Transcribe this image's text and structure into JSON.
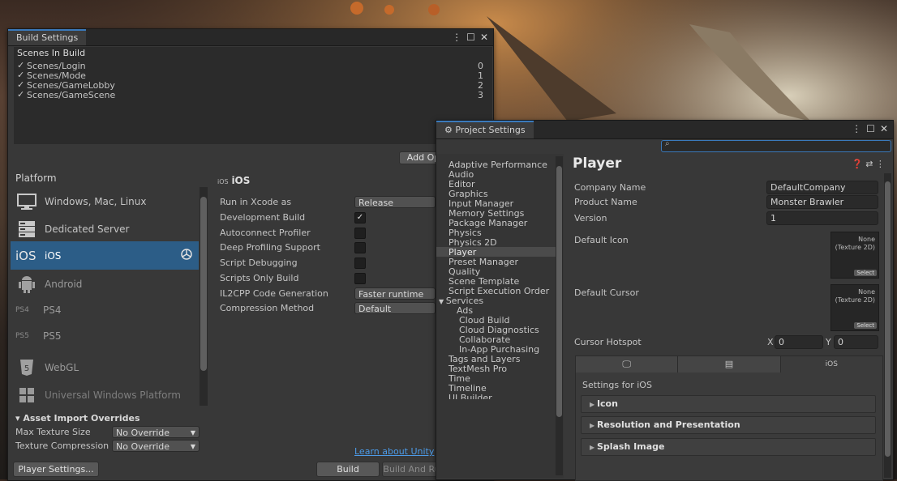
{
  "build_settings": {
    "tab_title": "Build Settings",
    "scenes_header": "Scenes In Build",
    "scenes": [
      {
        "name": "Scenes/Login",
        "index": "0"
      },
      {
        "name": "Scenes/Mode",
        "index": "1"
      },
      {
        "name": "Scenes/GameLobby",
        "index": "2"
      },
      {
        "name": "Scenes/GameScene",
        "index": "3"
      }
    ],
    "add_open_scenes": "Add Op",
    "platform_header": "Platform",
    "platforms": [
      {
        "label": "Windows, Mac, Linux",
        "icon": "monitor-icon"
      },
      {
        "label": "Dedicated Server",
        "icon": "server-icon"
      },
      {
        "label": "iOS",
        "prefix": "iOS",
        "icon": "ios-icon",
        "selected": true
      },
      {
        "label": "Android",
        "icon": "android-icon"
      },
      {
        "label": "PS4",
        "prefix": "PS4",
        "icon": "ps4-icon"
      },
      {
        "label": "PS5",
        "prefix": "PS5",
        "icon": "ps5-icon"
      },
      {
        "label": "WebGL",
        "icon": "html5-icon"
      },
      {
        "label": "Universal Windows Platform",
        "icon": "windows-icon"
      }
    ],
    "ios_title_prefix": "iOS",
    "ios_title": "iOS",
    "options": {
      "run_in_xcode": {
        "label": "Run in Xcode as",
        "value": "Release"
      },
      "development_build": {
        "label": "Development Build",
        "checked": true
      },
      "autoconnect_profiler": {
        "label": "Autoconnect Profiler",
        "checked": false
      },
      "deep_profiling": {
        "label": "Deep Profiling Support",
        "checked": false
      },
      "script_debugging": {
        "label": "Script Debugging",
        "checked": false
      },
      "scripts_only_build": {
        "label": "Scripts Only Build",
        "checked": false
      },
      "il2cpp": {
        "label": "IL2CPP Code Generation",
        "value": "Faster runtime"
      },
      "compression": {
        "label": "Compression Method",
        "value": "Default"
      }
    },
    "asset_import_overrides": "Asset Import Overrides",
    "max_texture_size": {
      "label": "Max Texture Size",
      "value": "No Override"
    },
    "texture_compression": {
      "label": "Texture Compression",
      "value": "No Override"
    },
    "learn_link": "Learn about Unity",
    "player_settings_button": "Player Settings...",
    "build_button": "Build",
    "build_and_run_button": "Build And Run"
  },
  "project_settings": {
    "tab_title": "Project Settings",
    "search_placeholder": "",
    "menu": [
      "Adaptive Performance",
      "Audio",
      "Editor",
      "Graphics",
      "Input Manager",
      "Memory Settings",
      "Package Manager",
      "Physics",
      "Physics 2D",
      "Player",
      "Preset Manager",
      "Quality",
      "Scene Template",
      "Script Execution Order",
      "Services",
      "Ads",
      "Cloud Build",
      "Cloud Diagnostics",
      "Collaborate",
      "In-App Purchasing",
      "Tags and Layers",
      "TextMesh Pro",
      "Time",
      "Timeline",
      "UI Builder"
    ],
    "selected_menu": "Player",
    "player": {
      "title": "Player",
      "company_name_label": "Company Name",
      "company_name": "DefaultCompany",
      "product_name_label": "Product Name",
      "product_name": "Monster Brawler",
      "version_label": "Version",
      "version": "1",
      "default_icon_label": "Default Icon",
      "default_cursor_label": "Default Cursor",
      "texture_none": "None",
      "texture_type": "(Texture 2D)",
      "select": "Select",
      "cursor_hotspot_label": "Cursor Hotspot",
      "x_label": "X",
      "x_value": "0",
      "y_label": "Y",
      "y_value": "0",
      "platform_tab_ios": "iOS",
      "settings_for": "Settings for iOS",
      "sections": [
        "Icon",
        "Resolution and Presentation",
        "Splash Image"
      ]
    }
  },
  "colors": {
    "accent": "#3a79bb",
    "selected_row": "#2c5d87",
    "panel": "#383838"
  }
}
